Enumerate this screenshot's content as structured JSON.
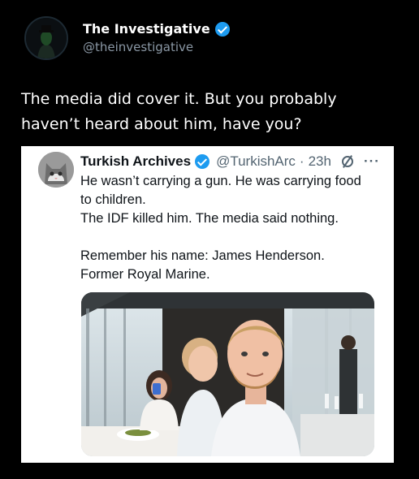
{
  "header": {
    "display_name": "The Investigative",
    "handle": "@theinvestigative"
  },
  "post": {
    "text_line_1": "The media did cover it. But you probably",
    "text_line_2": "haven’t heard about him, have you?"
  },
  "quoted": {
    "display_name": "Turkish Archives",
    "handle": "@TurkishArc",
    "separator": "·",
    "time": "23h",
    "more": "···",
    "lines": [
      "He wasn’t carrying a gun. He was carrying food",
      "to children.",
      "The IDF killed him. The media said nothing.",
      "",
      "Remember his name: James Henderson.",
      "Former Royal Marine."
    ]
  },
  "colors": {
    "background": "#000000",
    "verified": "#1d9bf0",
    "secondary_text": "#536471"
  }
}
